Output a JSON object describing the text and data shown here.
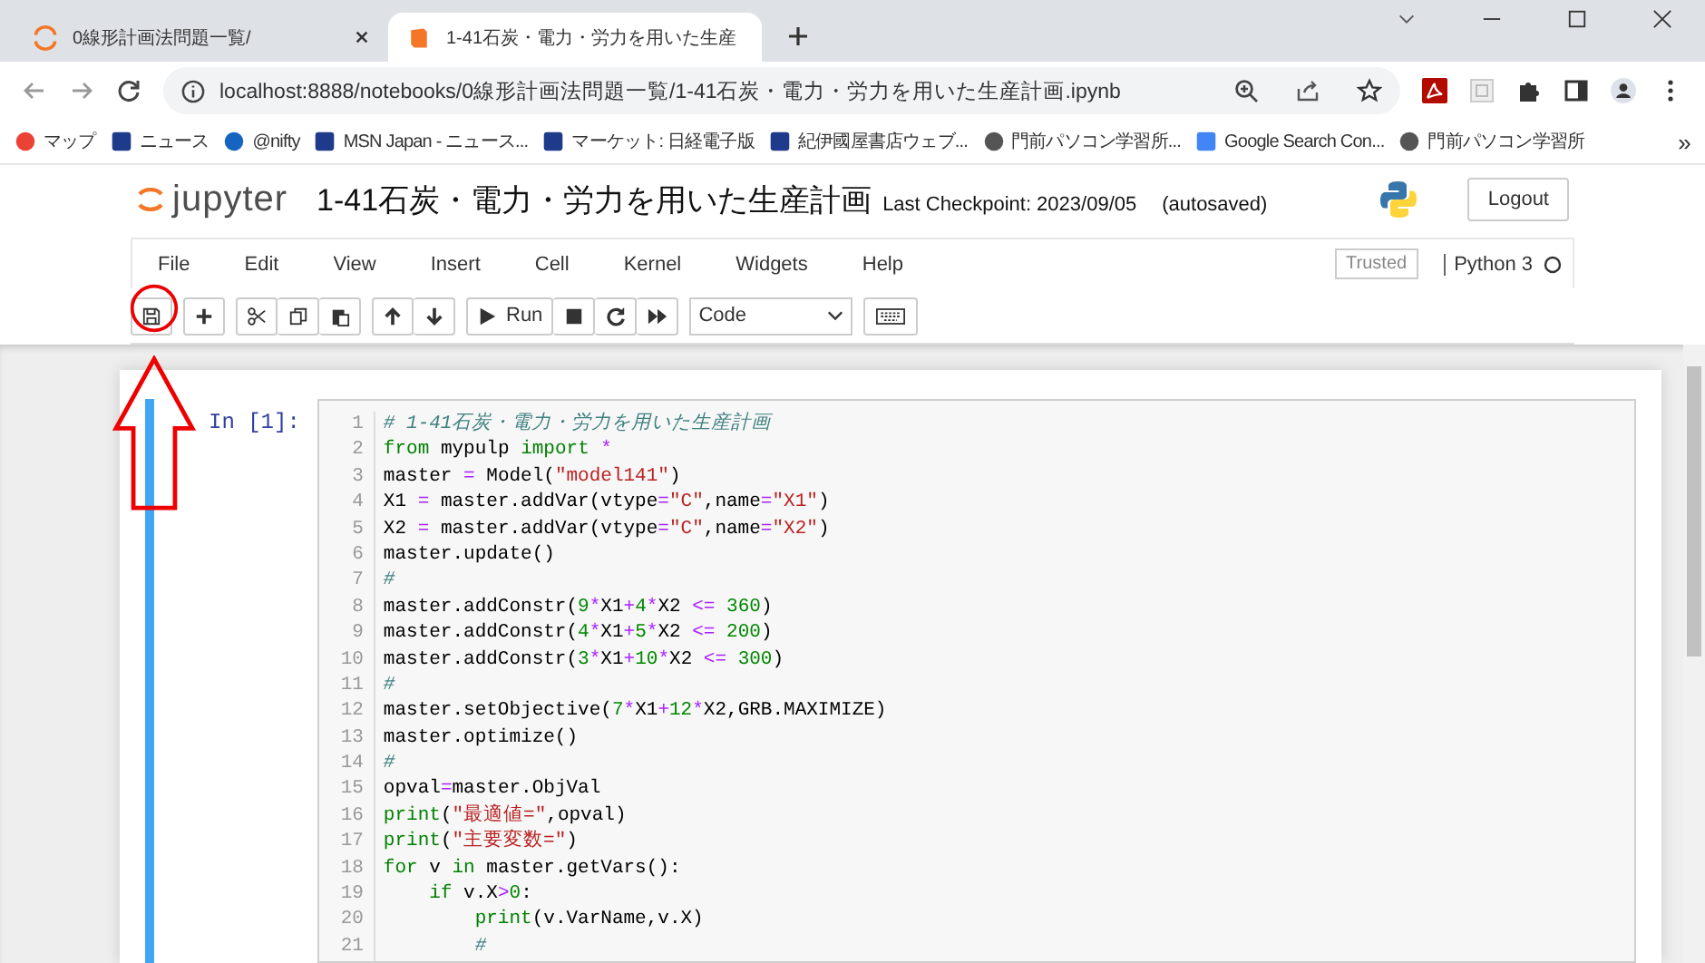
{
  "browser": {
    "tabs": [
      {
        "title": "0線形計画法問題一覧/",
        "selected": false
      },
      {
        "title": "1-41石炭・電力・労力を用いた生産",
        "selected": true
      }
    ],
    "url": "localhost:8888/notebooks/0線形計画法問題一覧/1-41石炭・電力・労力を用いた生産計画.ipynb",
    "bookmarks": [
      {
        "label": "マップ",
        "kind": "pin"
      },
      {
        "label": "ニュース",
        "kind": "square"
      },
      {
        "label": "@nifty",
        "kind": "round"
      },
      {
        "label": "MSN Japan - ニュース...",
        "kind": "square"
      },
      {
        "label": "マーケット: 日経電子版",
        "kind": "square"
      },
      {
        "label": "紀伊國屋書店ウェブ...",
        "kind": "square"
      },
      {
        "label": "門前パソコン学習所...",
        "kind": "globe"
      },
      {
        "label": "Google Search Con...",
        "kind": "google"
      },
      {
        "label": "門前パソコン学習所",
        "kind": "globe"
      }
    ],
    "more": "»"
  },
  "jupyter": {
    "logo_text": "jupyter",
    "title": "1-41石炭・電力・労力を用いた生産計画",
    "checkpoint": "Last Checkpoint: 2023/09/05",
    "autosave": "(autosaved)",
    "logout": "Logout",
    "menu": [
      "File",
      "Edit",
      "View",
      "Insert",
      "Cell",
      "Kernel",
      "Widgets",
      "Help"
    ],
    "trusted": "Trusted",
    "kernel": "Python 3",
    "kernel_busy": false,
    "toolbar": {
      "run": "Run",
      "cell_type": "Code"
    }
  },
  "cell": {
    "prompt": "In [1]:",
    "selected": true,
    "lines": [
      {
        "n": "1",
        "tokens": [
          {
            "text": "# 1-41石炭・電力・労力を用いた生産計画",
            "kind": "comment"
          }
        ]
      },
      {
        "n": "2",
        "tokens": [
          {
            "text": "from",
            "kind": "keyword"
          },
          {
            "text": " mypulp ",
            "kind": "plain"
          },
          {
            "text": "import ",
            "kind": "keyword"
          },
          {
            "text": "*",
            "kind": "operator"
          }
        ]
      },
      {
        "n": "3",
        "tokens": [
          {
            "text": "master ",
            "kind": "plain"
          },
          {
            "text": "=",
            "kind": "operator"
          },
          {
            "text": " Model(",
            "kind": "plain"
          },
          {
            "text": "\"model141\"",
            "kind": "string"
          },
          {
            "text": ")",
            "kind": "plain"
          }
        ]
      },
      {
        "n": "4",
        "tokens": [
          {
            "text": "X1 ",
            "kind": "plain"
          },
          {
            "text": "=",
            "kind": "operator"
          },
          {
            "text": " master.addVar(vtype",
            "kind": "plain"
          },
          {
            "text": "=",
            "kind": "operator"
          },
          {
            "text": "\"C\"",
            "kind": "string"
          },
          {
            "text": ",name",
            "kind": "plain"
          },
          {
            "text": "=",
            "kind": "operator"
          },
          {
            "text": "\"X1\"",
            "kind": "string"
          },
          {
            "text": ")",
            "kind": "plain"
          }
        ]
      },
      {
        "n": "5",
        "tokens": [
          {
            "text": "X2 ",
            "kind": "plain"
          },
          {
            "text": "=",
            "kind": "operator"
          },
          {
            "text": " master.addVar(vtype",
            "kind": "plain"
          },
          {
            "text": "=",
            "kind": "operator"
          },
          {
            "text": "\"C\"",
            "kind": "string"
          },
          {
            "text": ",name",
            "kind": "plain"
          },
          {
            "text": "=",
            "kind": "operator"
          },
          {
            "text": "\"X2\"",
            "kind": "string"
          },
          {
            "text": ")",
            "kind": "plain"
          }
        ]
      },
      {
        "n": "6",
        "tokens": [
          {
            "text": "master.update()",
            "kind": "plain"
          }
        ]
      },
      {
        "n": "7",
        "tokens": [
          {
            "text": "#",
            "kind": "comment"
          }
        ]
      },
      {
        "n": "8",
        "tokens": [
          {
            "text": "master.addConstr(",
            "kind": "plain"
          },
          {
            "text": "9",
            "kind": "number"
          },
          {
            "text": "*",
            "kind": "operator"
          },
          {
            "text": "X1",
            "kind": "plain"
          },
          {
            "text": "+",
            "kind": "operator"
          },
          {
            "text": "4",
            "kind": "number"
          },
          {
            "text": "*",
            "kind": "operator"
          },
          {
            "text": "X2 ",
            "kind": "plain"
          },
          {
            "text": "<=",
            "kind": "operator"
          },
          {
            "text": " 360",
            "kind": "number"
          },
          {
            "text": ")",
            "kind": "plain"
          }
        ]
      },
      {
        "n": "9",
        "tokens": [
          {
            "text": "master.addConstr(",
            "kind": "plain"
          },
          {
            "text": "4",
            "kind": "number"
          },
          {
            "text": "*",
            "kind": "operator"
          },
          {
            "text": "X1",
            "kind": "plain"
          },
          {
            "text": "+",
            "kind": "operator"
          },
          {
            "text": "5",
            "kind": "number"
          },
          {
            "text": "*",
            "kind": "operator"
          },
          {
            "text": "X2 ",
            "kind": "plain"
          },
          {
            "text": "<=",
            "kind": "operator"
          },
          {
            "text": " 200",
            "kind": "number"
          },
          {
            "text": ")",
            "kind": "plain"
          }
        ]
      },
      {
        "n": "10",
        "tokens": [
          {
            "text": "master.addConstr(",
            "kind": "plain"
          },
          {
            "text": "3",
            "kind": "number"
          },
          {
            "text": "*",
            "kind": "operator"
          },
          {
            "text": "X1",
            "kind": "plain"
          },
          {
            "text": "+",
            "kind": "operator"
          },
          {
            "text": "10",
            "kind": "number"
          },
          {
            "text": "*",
            "kind": "operator"
          },
          {
            "text": "X2 ",
            "kind": "plain"
          },
          {
            "text": "<=",
            "kind": "operator"
          },
          {
            "text": " 300",
            "kind": "number"
          },
          {
            "text": ")",
            "kind": "plain"
          }
        ]
      },
      {
        "n": "11",
        "tokens": [
          {
            "text": "#",
            "kind": "comment"
          }
        ]
      },
      {
        "n": "12",
        "tokens": [
          {
            "text": "master.setObjective(",
            "kind": "plain"
          },
          {
            "text": "7",
            "kind": "number"
          },
          {
            "text": "*",
            "kind": "operator"
          },
          {
            "text": "X1",
            "kind": "plain"
          },
          {
            "text": "+",
            "kind": "operator"
          },
          {
            "text": "12",
            "kind": "number"
          },
          {
            "text": "*",
            "kind": "operator"
          },
          {
            "text": "X2,GRB.MAXIMIZE)",
            "kind": "plain"
          }
        ]
      },
      {
        "n": "13",
        "tokens": [
          {
            "text": "master.optimize()",
            "kind": "plain"
          }
        ]
      },
      {
        "n": "14",
        "tokens": [
          {
            "text": "#",
            "kind": "comment"
          }
        ]
      },
      {
        "n": "15",
        "tokens": [
          {
            "text": "opval",
            "kind": "plain"
          },
          {
            "text": "=",
            "kind": "operator"
          },
          {
            "text": "master.ObjVal",
            "kind": "plain"
          }
        ]
      },
      {
        "n": "16",
        "tokens": [
          {
            "text": "print",
            "kind": "keyword"
          },
          {
            "text": "(",
            "kind": "plain"
          },
          {
            "text": "\"最適値=\"",
            "kind": "string"
          },
          {
            "text": ",opval)",
            "kind": "plain"
          }
        ]
      },
      {
        "n": "17",
        "tokens": [
          {
            "text": "print",
            "kind": "keyword"
          },
          {
            "text": "(",
            "kind": "plain"
          },
          {
            "text": "\"主要変数=\"",
            "kind": "string"
          },
          {
            "text": ")",
            "kind": "plain"
          }
        ]
      },
      {
        "n": "18",
        "tokens": [
          {
            "text": "for",
            "kind": "keyword"
          },
          {
            "text": " v ",
            "kind": "plain"
          },
          {
            "text": "in",
            "kind": "keyword"
          },
          {
            "text": " master.getVars():",
            "kind": "plain"
          }
        ]
      },
      {
        "n": "19",
        "tokens": [
          {
            "text": "    if",
            "kind": "keyword"
          },
          {
            "text": " v.X",
            "kind": "plain"
          },
          {
            "text": ">",
            "kind": "operator"
          },
          {
            "text": "0",
            "kind": "number"
          },
          {
            "text": ":",
            "kind": "plain"
          }
        ]
      },
      {
        "n": "20",
        "tokens": [
          {
            "text": "        print",
            "kind": "keyword"
          },
          {
            "text": "(v.VarName,v.X)",
            "kind": "plain"
          }
        ]
      },
      {
        "n": "21",
        "tokens": [
          {
            "text": "        #",
            "kind": "comment"
          }
        ]
      }
    ]
  }
}
